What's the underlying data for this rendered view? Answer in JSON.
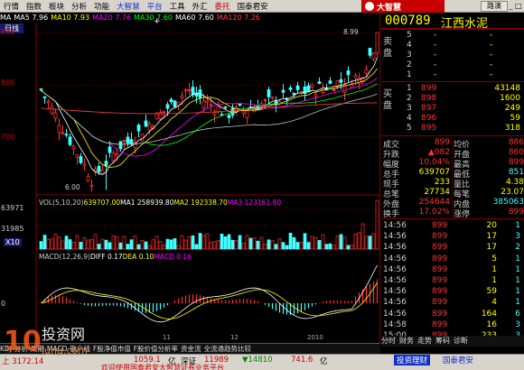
{
  "menu": {
    "items": [
      {
        "label": "行情",
        "color": "black"
      },
      {
        "label": "指数",
        "color": "black"
      },
      {
        "label": "板块",
        "color": "black"
      },
      {
        "label": "分析",
        "color": "black"
      },
      {
        "label": "功能",
        "color": "black"
      },
      {
        "label": "大智慧",
        "color": "blue"
      },
      {
        "label": "平台",
        "color": "blue"
      },
      {
        "label": "工具",
        "color": "black"
      },
      {
        "label": "外汇",
        "color": "black"
      },
      {
        "label": "委托",
        "color": "red"
      },
      {
        "label": "国泰君安",
        "color": "black"
      }
    ],
    "logo": "大智慧",
    "route_button": "路演",
    "window_controls": "_ □ ×"
  },
  "chart": {
    "ma_legend": [
      {
        "text": "MA",
        "color": "#ffffff"
      },
      {
        "text": "MA5 7.96",
        "color": "#ffffff"
      },
      {
        "text": "MA10 7.93",
        "color": "#ffff00"
      },
      {
        "text": "MA20 7.76",
        "color": "#ff00ff"
      },
      {
        "text": "MA30 7.60",
        "color": "#00ff00"
      },
      {
        "text": "MA60 7.60",
        "color": "#ffffff"
      },
      {
        "text": "MA120 7.26",
        "color": "#ff4040"
      }
    ],
    "period_label": "日线",
    "price_labels": [
      "899",
      "800",
      "700"
    ],
    "high_marker": "8.99",
    "low_marker": "6.00",
    "vol_legend": [
      {
        "text": "VOL(5,10,20)",
        "color": "#cccccc"
      },
      {
        "text": "639707.00",
        "color": "#ffff00"
      },
      {
        "text": "MA1 258939.80",
        "color": "#ffffff"
      },
      {
        "text": "MA2 192338.70",
        "color": "#ffff00"
      },
      {
        "text": "MA3 123161.80",
        "color": "#ff00ff"
      }
    ],
    "vol_labels": [
      "63971",
      "31985"
    ],
    "vol_unit": "X10",
    "macd_legend": [
      {
        "text": "MACD(12,26,9)",
        "color": "#cccccc"
      },
      {
        "text": "DIFF 0.17",
        "color": "#ffffff"
      },
      {
        "text": "DEA 0.10",
        "color": "#ffff00"
      },
      {
        "text": "MACD 0.16",
        "color": "#ff00ff"
      }
    ],
    "xaxis_labels": [
      "11",
      "12",
      "2010"
    ],
    "macd_zero": "0",
    "colors": {
      "up": "#ff3030",
      "down": "#40ffff",
      "grid": "#800000"
    }
  },
  "quote": {
    "code": "000789",
    "name": "江西水泥",
    "sell_label": "卖盘",
    "buy_label": "买盘",
    "sells": [
      {
        "level": "5",
        "price": "-",
        "vol": "-"
      },
      {
        "level": "4",
        "price": "-",
        "vol": "-"
      },
      {
        "level": "3",
        "price": "-",
        "vol": "-"
      },
      {
        "level": "2",
        "price": "-",
        "vol": "-"
      },
      {
        "level": "1",
        "price": "-",
        "vol": "-"
      }
    ],
    "buys": [
      {
        "level": "1",
        "price": "899",
        "vol": "43148"
      },
      {
        "level": "2",
        "price": "898",
        "vol": "1600"
      },
      {
        "level": "3",
        "price": "897",
        "vol": "249"
      },
      {
        "level": "4",
        "price": "896",
        "vol": "59"
      },
      {
        "level": "5",
        "price": "895",
        "vol": "318"
      }
    ],
    "stats": [
      {
        "k1": "成交",
        "v1": "899",
        "k2": "均价",
        "v2": "886"
      },
      {
        "k1": "升跌",
        "v1": "▲082",
        "k2": "开盘",
        "v2": "860"
      },
      {
        "k1": "幅度",
        "v1": "10.04%",
        "k2": "最高",
        "v2": "899"
      },
      {
        "k1": "总手",
        "v1": "639707",
        "k2": "最低",
        "v2": "851"
      },
      {
        "k1": "现手",
        "v1": "233",
        "k2": "量比",
        "v2": "4.38"
      },
      {
        "k1": "总笔",
        "v1": "27734",
        "k2": "每笔",
        "v2": "23.07"
      },
      {
        "k1": "外盘",
        "v1": "254644",
        "k2": "内盘",
        "v2": "385063"
      },
      {
        "k1": "换手",
        "v1": "17.02%",
        "k2": "涨停",
        "v2": "899"
      }
    ],
    "ticks": [
      {
        "time": "14:56",
        "price": "899",
        "vol": "20",
        "flag": "1"
      },
      {
        "time": "14:56",
        "price": "899",
        "vol": "17",
        "flag": "3"
      },
      {
        "time": "14:56",
        "price": "899",
        "vol": "17",
        "flag": "2"
      },
      {
        "time": "14:56",
        "price": "899",
        "vol": "5",
        "flag": "1"
      },
      {
        "time": "14:56",
        "price": "899",
        "vol": "1",
        "flag": "1"
      },
      {
        "time": "14:56",
        "price": "899",
        "vol": "1",
        "flag": "1"
      },
      {
        "time": "14:56",
        "price": "899",
        "vol": "59",
        "flag": "1"
      },
      {
        "time": "14:56",
        "price": "899",
        "vol": "4",
        "flag": "1"
      },
      {
        "time": "14:56",
        "price": "899",
        "vol": "164",
        "flag": "6"
      },
      {
        "time": "14:58",
        "price": "899",
        "vol": "16",
        "flag": "3"
      },
      {
        "time": "15:00",
        "price": "899",
        "vol": "233",
        "flag": "3"
      }
    ]
  },
  "bottom_tabs": [
    "KDJ",
    "分析",
    "周期",
    "MACD",
    "散户线",
    "F股净值市值",
    "F股价值分析率",
    "资金流",
    "全流通趋势比较"
  ],
  "quote_tabs": [
    "分时",
    "财务",
    "走势",
    "筹码",
    "诊断"
  ],
  "status": {
    "idx1": "上 3172.14",
    "idx1b": "1059.1",
    "idx1c": "亿",
    "idx2": "深证",
    "idx2v": "11989",
    "idx2c": "▼14810",
    "idx2d": "741.6",
    "idx2e": "亿",
    "ticker": "欢迎使用国泰君安大智慧证券业务平台",
    "btn": "投资理财",
    "btn2": "国泰君安"
  },
  "watermark": {
    "big": "10",
    "text": "投资网",
    "url": "juhg.com"
  }
}
